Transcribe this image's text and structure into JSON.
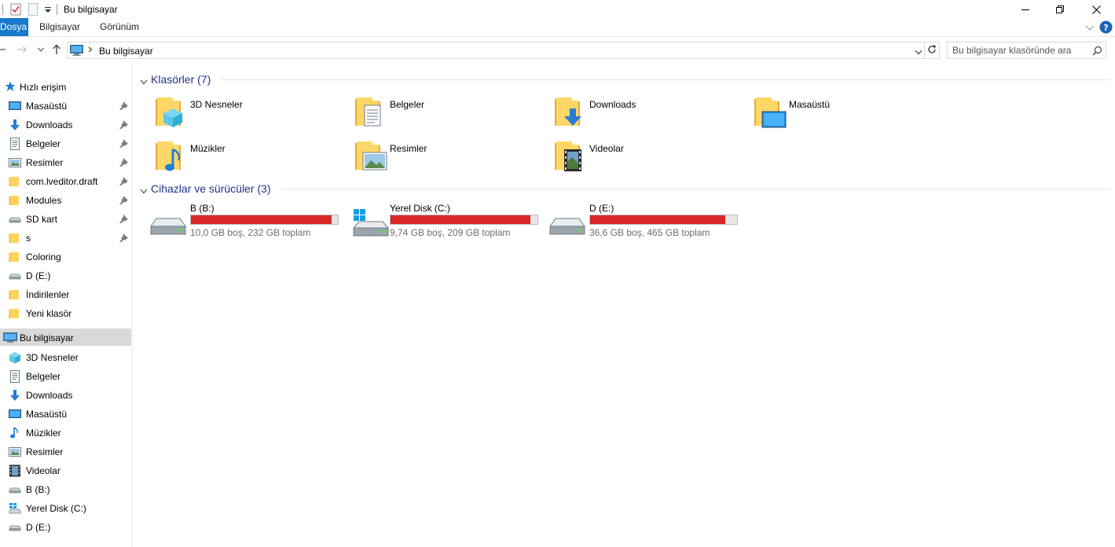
{
  "window": {
    "title": "Bu bilgisayar"
  },
  "ribbon": {
    "tabs": [
      "Dosya",
      "Bilgisayar",
      "Görünüm"
    ]
  },
  "address": {
    "path": "Bu bilgisayar",
    "search_placeholder": "Bu bilgisayar klasöründe ara"
  },
  "sidebar": {
    "quick_access_label": "Hızlı erişim",
    "quick_access": [
      {
        "label": "Masaüstü",
        "icon": "desktop-icon",
        "pinned": true
      },
      {
        "label": "Downloads",
        "icon": "download-icon",
        "pinned": true
      },
      {
        "label": "Belgeler",
        "icon": "documents-icon",
        "pinned": true
      },
      {
        "label": "Resimler",
        "icon": "pictures-icon",
        "pinned": true
      },
      {
        "label": "com.lveditor.draft",
        "icon": "folder-icon",
        "pinned": true
      },
      {
        "label": "Modules",
        "icon": "folder-icon",
        "pinned": true
      },
      {
        "label": "SD kart",
        "icon": "drive-icon",
        "pinned": true
      },
      {
        "label": "s",
        "icon": "folder-icon",
        "pinned": true
      },
      {
        "label": "Coloring",
        "icon": "folder-icon",
        "pinned": false
      },
      {
        "label": "D (E:)",
        "icon": "drive-icon",
        "pinned": false
      },
      {
        "label": "İndirilenler",
        "icon": "folder-icon",
        "pinned": false
      },
      {
        "label": "Yeni klasör",
        "icon": "folder-icon",
        "pinned": false
      }
    ],
    "this_pc_label": "Bu bilgisayar",
    "this_pc": [
      {
        "label": "3D Nesneler",
        "icon": "3d-objects-icon"
      },
      {
        "label": "Belgeler",
        "icon": "documents-icon"
      },
      {
        "label": "Downloads",
        "icon": "download-icon"
      },
      {
        "label": "Masaüstü",
        "icon": "desktop-icon"
      },
      {
        "label": "Müzikler",
        "icon": "music-icon"
      },
      {
        "label": "Resimler",
        "icon": "pictures-icon"
      },
      {
        "label": "Videolar",
        "icon": "videos-icon"
      },
      {
        "label": "B (B:)",
        "icon": "drive-icon"
      },
      {
        "label": "Yerel Disk (C:)",
        "icon": "windows-drive-icon"
      },
      {
        "label": "D (E:)",
        "icon": "drive-icon"
      }
    ]
  },
  "main": {
    "folders_header": "Klasörler (7)",
    "folders": [
      {
        "label": "3D Nesneler",
        "icon": "3d-objects-folder-icon"
      },
      {
        "label": "Belgeler",
        "icon": "documents-folder-icon"
      },
      {
        "label": "Downloads",
        "icon": "downloads-folder-icon"
      },
      {
        "label": "Masaüstü",
        "icon": "desktop-folder-icon"
      },
      {
        "label": "Müzikler",
        "icon": "music-folder-icon"
      },
      {
        "label": "Resimler",
        "icon": "pictures-folder-icon"
      },
      {
        "label": "Videolar",
        "icon": "videos-folder-icon"
      }
    ],
    "drives_header": "Cihazlar ve sürücüler (3)",
    "drives": [
      {
        "name": "B (B:)",
        "free_text": "10,0 GB boş, 232 GB toplam",
        "used_fraction": 0.957,
        "icon": "drive-icon"
      },
      {
        "name": "Yerel Disk (C:)",
        "free_text": "9,74 GB boş, 209 GB toplam",
        "used_fraction": 0.953,
        "icon": "windows-drive-icon"
      },
      {
        "name": "D (E:)",
        "free_text": "36,6 GB boş, 465 GB toplam",
        "used_fraction": 0.921,
        "icon": "drive-icon"
      }
    ]
  },
  "colors": {
    "accent": "#1979ca",
    "drive_full": "#da2626",
    "group_header": "#1e3287",
    "selection": "#d9d9d9"
  }
}
